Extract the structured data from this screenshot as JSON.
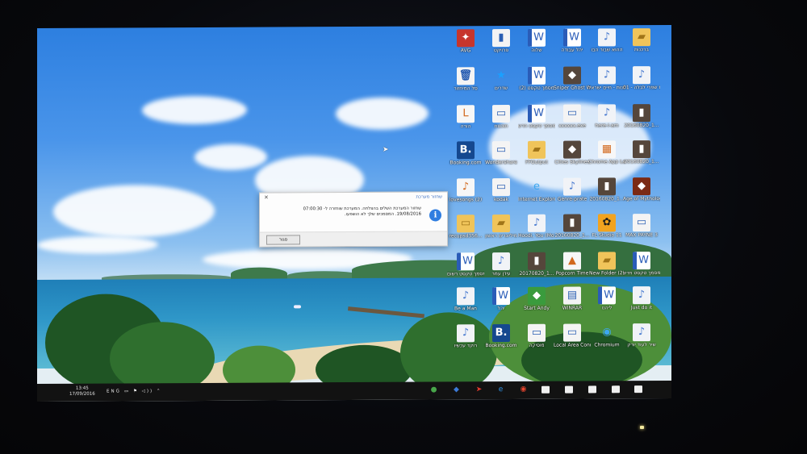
{
  "dialog": {
    "title": "שחזור מערכת",
    "close": "×",
    "message": "שחזור המערכת השלים בהצלחה. המערכת שוחזרה ל- 07:00:30 19/08/2016. המסמכים שלך לא הושפעו.",
    "info_glyph": "i",
    "button": "סגור"
  },
  "taskbar": {
    "time": "13:45",
    "date": "17/09/2016",
    "lang": "ENG",
    "sys_icons": "▭ ⚑ ◁)) ⌃"
  },
  "desktop_icons": [
    {
      "label": "AVG",
      "glyph": "✦",
      "kind": "avg"
    },
    {
      "label": "פרויקט",
      "glyph": "▮",
      "kind": "doc"
    },
    {
      "label": "שלוה",
      "glyph": "W",
      "kind": "word"
    },
    {
      "label": "יהל עבודה",
      "glyph": "W",
      "kind": "word"
    },
    {
      "label": "ההוא שבור הבו",
      "glyph": "♪",
      "kind": "music"
    },
    {
      "label": "ברכנות",
      "glyph": "▰",
      "kind": "folder"
    },
    {
      "label": "סל המיחזור",
      "glyph": "🗑",
      "kind": "doc"
    },
    {
      "label": "שדרים",
      "glyph": "★",
      "kind": "star"
    },
    {
      "label": "מסמך טקסט (2)",
      "glyph": "W",
      "kind": "word"
    },
    {
      "label": "Sniper Ghost Warrior 2",
      "glyph": "◆",
      "kind": "img"
    },
    {
      "label": "ביחנות - חיים ישראל",
      "glyph": "♪",
      "kind": "music"
    },
    {
      "label": "01 - עוז זוז שפרי לבלה",
      "glyph": "♪",
      "kind": "music"
    },
    {
      "label": "הורה",
      "glyph": "L",
      "kind": "white"
    },
    {
      "label": "תוכנות",
      "glyph": "▭",
      "kind": "doc"
    },
    {
      "label": "מסמך טקסט חדש",
      "glyph": "W",
      "kind": "word"
    },
    {
      "label": "xxxxxx.exe",
      "glyph": "▭",
      "kind": "doc"
    },
    {
      "label": "here-i-am",
      "glyph": "♪",
      "kind": "music"
    },
    {
      "label": "20160820_1...",
      "glyph": "▮",
      "kind": "img"
    },
    {
      "label": "Booking.com",
      "glyph": "B.",
      "kind": "booking"
    },
    {
      "label": "Wondershare",
      "glyph": "▭",
      "kind": "doc"
    },
    {
      "label": "FFOutput",
      "glyph": "▰",
      "kind": "folder"
    },
    {
      "label": "Cities Skylines",
      "glyph": "◆",
      "kind": "img"
    },
    {
      "label": "Chrome App Launcher",
      "glyph": "▦",
      "kind": "white"
    },
    {
      "label": "20160820_1...",
      "glyph": "▮",
      "kind": "img"
    },
    {
      "label": "lovesongs (2)",
      "glyph": "♪",
      "kind": "white"
    },
    {
      "label": "kodak",
      "glyph": "▭",
      "kind": "doc"
    },
    {
      "label": "Internet Explorer",
      "glyph": "e",
      "kind": "ie"
    },
    {
      "label": "Genre-prate",
      "glyph": "♪",
      "kind": "music"
    },
    {
      "label": "20160820_1...",
      "glyph": "▮",
      "kind": "img"
    },
    {
      "label": "Age of Mythology",
      "glyph": "◆",
      "kind": "app"
    },
    {
      "label": "recupsd356...",
      "glyph": "▭",
      "kind": "folder"
    },
    {
      "label": "מיליונרים ראשון",
      "glyph": "▰",
      "kind": "folder"
    },
    {
      "label": "Hoodi, You (Mo me...)",
      "glyph": "♪",
      "kind": "music"
    },
    {
      "label": "20160820_1...",
      "glyph": "▮",
      "kind": "img"
    },
    {
      "label": "FL Studio 11",
      "glyph": "✿",
      "kind": "fl"
    },
    {
      "label": "MAX PAYNE 3",
      "glyph": "▭",
      "kind": "doc"
    },
    {
      "label": "מסמך טקסט רשום",
      "glyph": "W",
      "kind": "word"
    },
    {
      "label": "עידן עמר",
      "glyph": "♪",
      "kind": "music"
    },
    {
      "label": "20170820_1...",
      "glyph": "▮",
      "kind": "img"
    },
    {
      "label": "Popcorn Time",
      "glyph": "▲",
      "kind": "white"
    },
    {
      "label": "New Folder (2)",
      "glyph": "▰",
      "kind": "folder"
    },
    {
      "label": "מסמך טקסט חדש",
      "glyph": "W",
      "kind": "word"
    },
    {
      "label": "Be a Man",
      "glyph": "♪",
      "kind": "music"
    },
    {
      "label": "יהל",
      "glyph": "W",
      "kind": "word"
    },
    {
      "label": "Start Andy",
      "glyph": "◆",
      "kind": "green"
    },
    {
      "label": "WINRAR",
      "glyph": "▤",
      "kind": "doc"
    },
    {
      "label": "ליהנו",
      "glyph": "W",
      "kind": "word"
    },
    {
      "label": "Just do it",
      "glyph": "♪",
      "kind": "music"
    },
    {
      "label": "רוקד עכשיו",
      "glyph": "♪",
      "kind": "music"
    },
    {
      "label": "Booking.com",
      "glyph": "B.",
      "kind": "booking"
    },
    {
      "label": "מוסיקה",
      "glyph": "▭",
      "kind": "doc"
    },
    {
      "label": "Local Area Connection",
      "glyph": "▭",
      "kind": "doc"
    },
    {
      "label": "Chromium",
      "glyph": "◉",
      "kind": "ie"
    },
    {
      "label": "שיר לעוד יורק",
      "glyph": "♪",
      "kind": "music"
    }
  ],
  "taskbar_apps": [
    {
      "name": "firefox",
      "glyph": "●",
      "color": "#48a64a"
    },
    {
      "name": "app-blue",
      "glyph": "◆",
      "color": "#3c79d6"
    },
    {
      "name": "app-red",
      "glyph": "➤",
      "color": "#e23b2e"
    },
    {
      "name": "edge",
      "glyph": "e",
      "color": "#2f8fe0"
    },
    {
      "name": "chrome",
      "glyph": "◉",
      "color": "#e9452f"
    }
  ]
}
